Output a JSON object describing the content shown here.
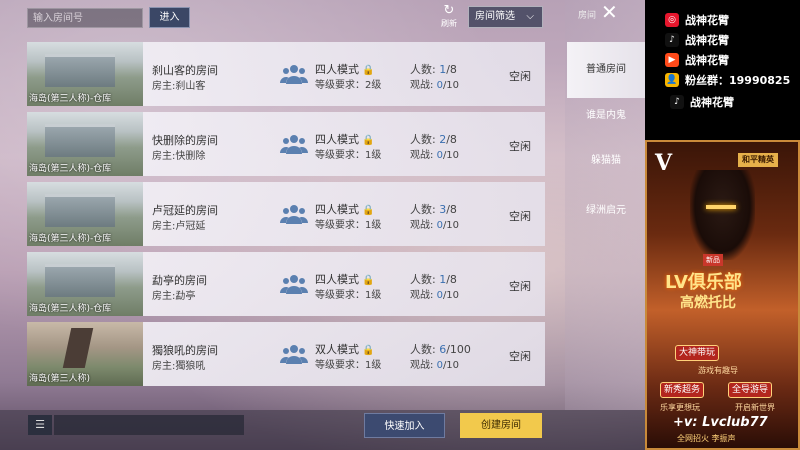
{
  "header": {
    "search_placeholder": "输入房间号",
    "enter_label": "进入",
    "refresh_label": "刷新",
    "filter_label": "房间筛选"
  },
  "side": {
    "title": "房间",
    "tabs": [
      "普通房间",
      "谁是内鬼",
      "躲猫猫",
      "绿洲启元"
    ],
    "active_tab": 0
  },
  "rooms": [
    {
      "map_caption": "海岛(第三人称)-仓库",
      "name": "刹山客的房间",
      "host": "房主:刹山客",
      "mode": "四人模式",
      "level": "等级要求：2级",
      "count_prefix": "人数: ",
      "count_cur": "1",
      "count_max": "/8",
      "watch_prefix": "观战: ",
      "watch_cur": "0",
      "watch_max": "/10",
      "status": "空闲",
      "thumb": "warehouse"
    },
    {
      "map_caption": "海岛(第三人称)-仓库",
      "name": "快删除的房间",
      "host": "房主:快删除",
      "mode": "四人模式",
      "level": "等级要求：1级",
      "count_prefix": "人数: ",
      "count_cur": "2",
      "count_max": "/8",
      "watch_prefix": "观战: ",
      "watch_cur": "0",
      "watch_max": "/10",
      "status": "空闲",
      "thumb": "warehouse"
    },
    {
      "map_caption": "海岛(第三人称)-仓库",
      "name": "卢冠延的房间",
      "host": "房主:卢冠延",
      "mode": "四人模式",
      "level": "等级要求：1级",
      "count_prefix": "人数: ",
      "count_cur": "3",
      "count_max": "/8",
      "watch_prefix": "观战: ",
      "watch_cur": "0",
      "watch_max": "/10",
      "status": "空闲",
      "thumb": "warehouse"
    },
    {
      "map_caption": "海岛(第三人称)-仓库",
      "name": "勐亭的房间",
      "host": "房主:勐亭",
      "mode": "四人模式",
      "level": "等级要求：1级",
      "count_prefix": "人数: ",
      "count_cur": "1",
      "count_max": "/8",
      "watch_prefix": "观战: ",
      "watch_cur": "0",
      "watch_max": "/10",
      "status": "空闲",
      "thumb": "warehouse"
    },
    {
      "map_caption": "海岛(第三人称)",
      "name": "獨狼吼的房间",
      "host": "房主:獨狼吼",
      "mode": "双人模式",
      "level": "等级要求：1级",
      "count_prefix": "人数: ",
      "count_cur": "6",
      "count_max": "/100",
      "watch_prefix": "观战: ",
      "watch_cur": "0",
      "watch_max": "/10",
      "status": "空闲",
      "thumb": "outdoor"
    }
  ],
  "footer": {
    "quick_join_label": "快速加入",
    "create_room_label": "创建房间"
  },
  "overlay": {
    "social": [
      {
        "platform": "weibo-icon",
        "text": "战神花臂",
        "color": "#e6162d"
      },
      {
        "platform": "douyin-icon",
        "text": "战神花臂",
        "color": "#111111"
      },
      {
        "platform": "kuaishou-icon",
        "text": "战神花臂",
        "color": "#ff4a1a"
      },
      {
        "platform": "fans-icon",
        "text": "粉丝群：19990825",
        "color": "#f7b500"
      },
      {
        "platform": "douyin-icon",
        "text": "战神花臂",
        "color": "#111111"
      }
    ],
    "ad": {
      "badge": "和平精英",
      "title": "高燃托比",
      "sub": "LV俱乐部",
      "pills": [
        "大神带玩",
        "新秀超务",
        "全导游导"
      ],
      "lines": [
        "游戏有趣导",
        "乐享更想玩",
        "开启新世界"
      ],
      "contact": "+v: Lvclub77",
      "foot": "全网招火 李振声"
    }
  },
  "colors": {
    "accent_blue": "#3a6fb0",
    "create_yellow": "#f2c94c"
  }
}
